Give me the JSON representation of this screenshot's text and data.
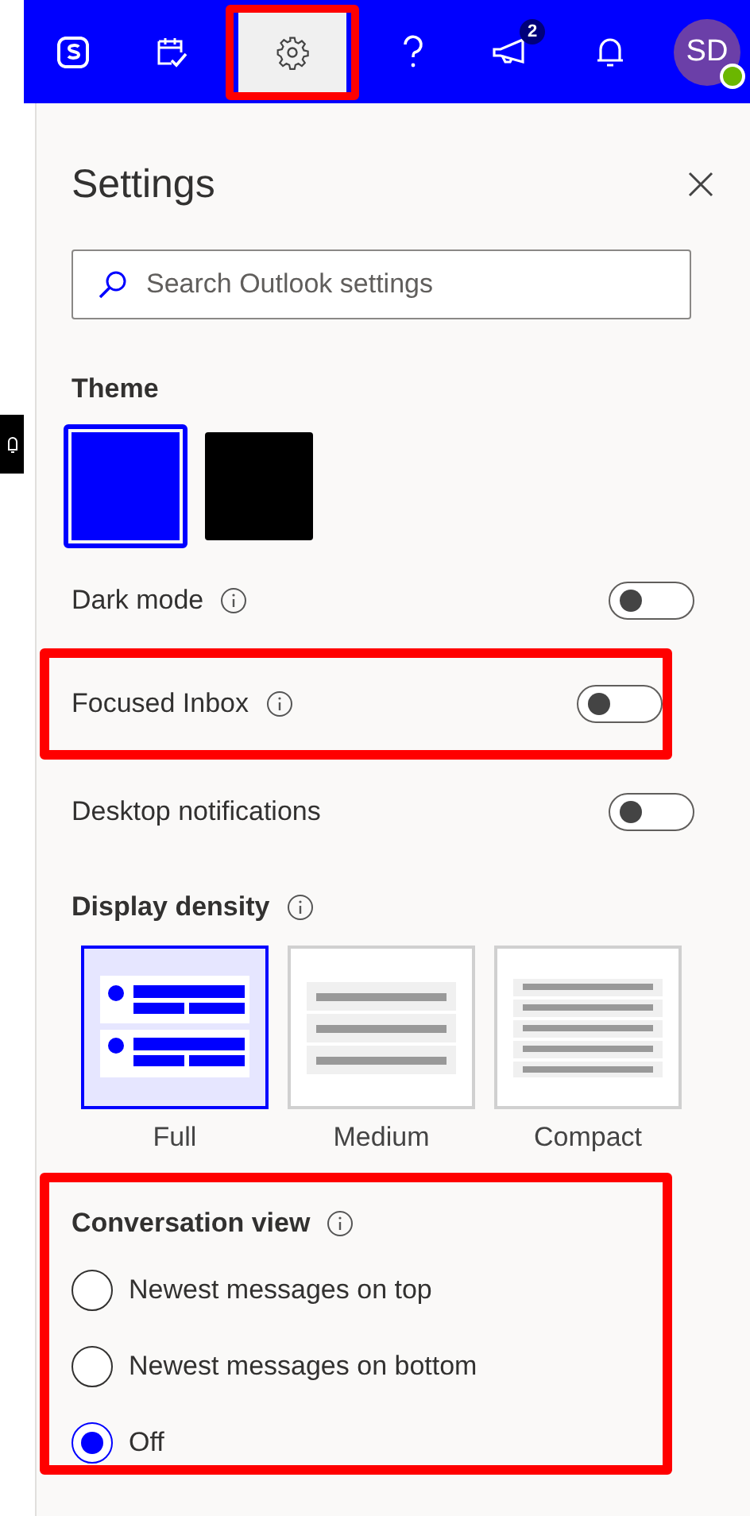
{
  "top_bar": {
    "buttons": [
      {
        "kind": "skype",
        "selected": false
      },
      {
        "kind": "todo",
        "selected": false
      },
      {
        "kind": "settings",
        "selected": true,
        "highlighted": true
      },
      {
        "kind": "help",
        "selected": false
      },
      {
        "kind": "feedback",
        "selected": false,
        "badge": "2"
      },
      {
        "kind": "bell",
        "selected": false
      }
    ],
    "avatar": {
      "initials": "SD",
      "online": true
    }
  },
  "settings": {
    "title": "Settings",
    "search": {
      "placeholder": "Search Outlook settings"
    },
    "theme": {
      "label": "Theme",
      "swatches": [
        {
          "color": "#0000ff",
          "selected": true
        },
        {
          "color": "#000000",
          "selected": false
        }
      ]
    },
    "toggles": [
      {
        "label": "Dark mode",
        "info": true,
        "on": false
      },
      {
        "label": "Focused Inbox",
        "info": true,
        "on": false,
        "highlighted": true
      },
      {
        "label": "Desktop notifications",
        "on": false
      }
    ],
    "density": {
      "label": "Display density",
      "options": [
        {
          "kind": "full",
          "label": "Full",
          "selected": true
        },
        {
          "kind": "medium",
          "label": "Medium",
          "selected": false
        },
        {
          "kind": "compact",
          "label": "Compact",
          "selected": false
        }
      ]
    },
    "conversation": {
      "label": "Conversation view",
      "highlighted": true,
      "options": [
        {
          "label": "Newest messages on top",
          "selected": false
        },
        {
          "label": "Newest messages on bottom",
          "selected": false
        },
        {
          "label": "Off",
          "selected": true
        }
      ]
    }
  }
}
